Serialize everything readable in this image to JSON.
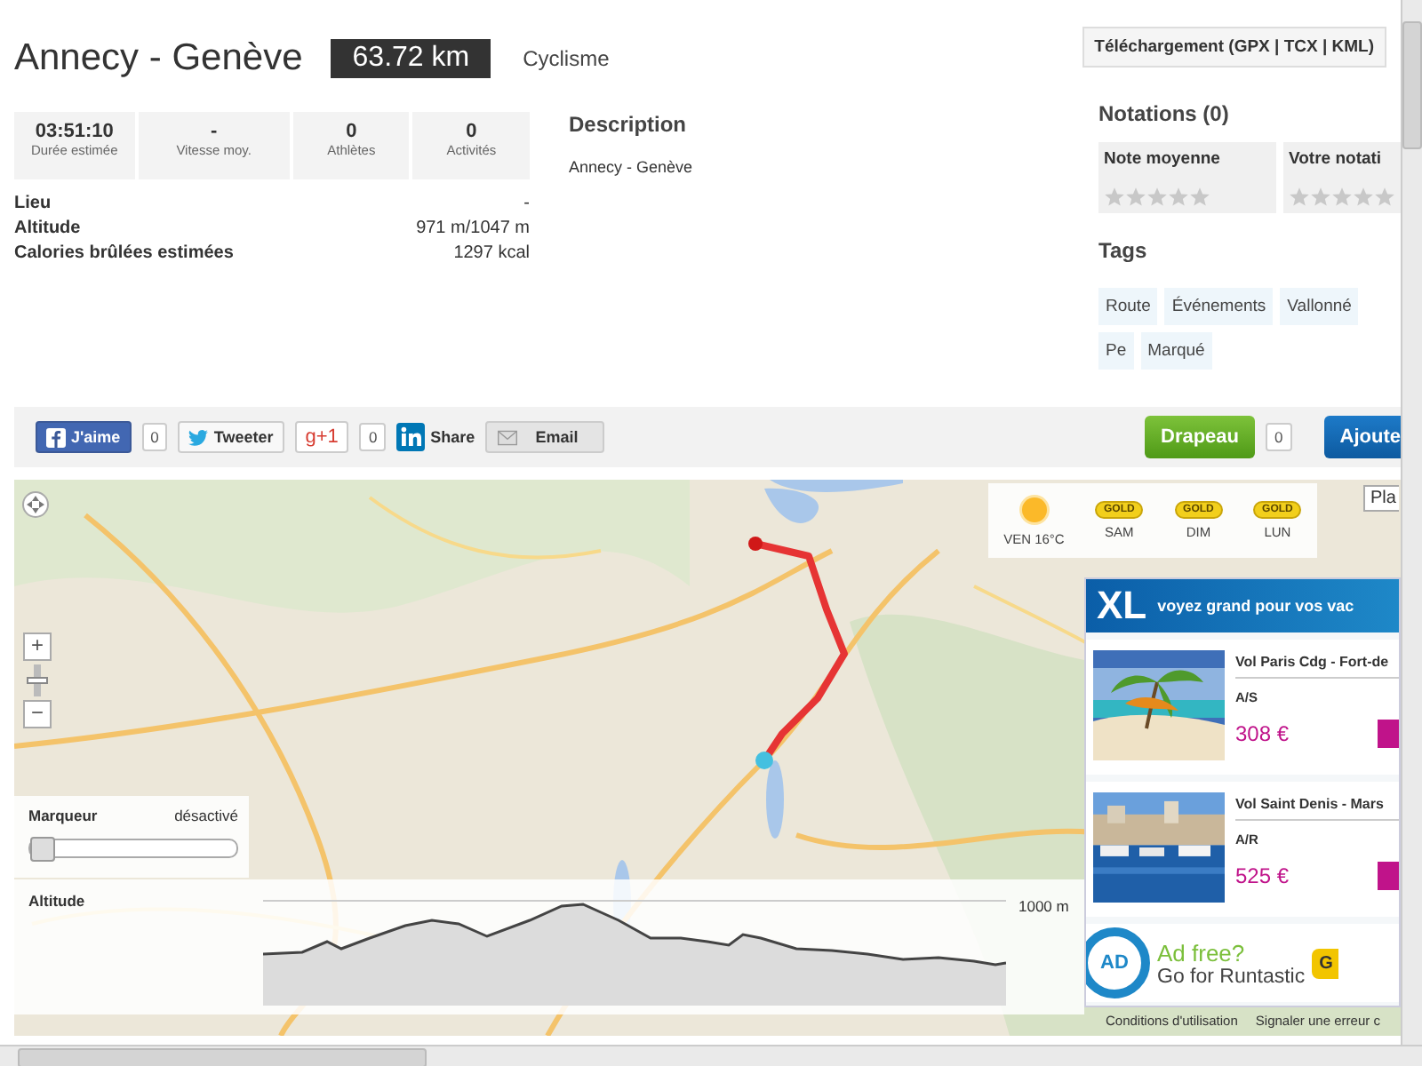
{
  "header": {
    "title": "Annecy - Genève",
    "distance": "63.72 km",
    "sport": "Cyclisme",
    "download": "Téléchargement (GPX | TCX | KML)"
  },
  "stats": [
    {
      "value": "03:51:10",
      "label": "Durée estimée"
    },
    {
      "value": "-",
      "label": "Vitesse moy."
    },
    {
      "value": "0",
      "label": "Athlètes"
    },
    {
      "value": "0",
      "label": "Activités"
    }
  ],
  "details": [
    {
      "label": "Lieu",
      "value": "-"
    },
    {
      "label": "Altitude",
      "value": "971 m/1047 m"
    },
    {
      "label": "Calories brûlées estimées",
      "value": "1297 kcal"
    }
  ],
  "description": {
    "heading": "Description",
    "text": "Annecy - Genève"
  },
  "ratings": {
    "heading": "Notations (0)",
    "boxes": [
      {
        "label": "Note moyenne",
        "stars": 0
      },
      {
        "label": "Votre notati",
        "stars": 0
      }
    ]
  },
  "tags": {
    "heading": "Tags",
    "items": [
      "Route",
      "Événements",
      "Vallonné",
      "Pe",
      "Marqué"
    ]
  },
  "social": [
    {
      "kind": "facebook",
      "label": "J'aime",
      "count": "0"
    },
    {
      "kind": "twitter",
      "label": "Tweeter"
    },
    {
      "kind": "gplus",
      "label": "g+1",
      "count": "0"
    },
    {
      "kind": "linkedin",
      "label": "Share"
    },
    {
      "kind": "email",
      "label": "Email"
    }
  ],
  "actions": [
    {
      "kind": "flag",
      "label": "Drapeau",
      "count": "0"
    },
    {
      "kind": "add",
      "label": "Ajoute"
    }
  ],
  "map": {
    "zoom": [
      "+",
      "−"
    ],
    "zoom_slider": {
      "level": 0.5
    },
    "weather": [
      {
        "kind": "sun",
        "day": "VEN 16°C"
      },
      {
        "kind": "badge",
        "badge": "GOLD",
        "day": "SAM"
      },
      {
        "kind": "badge",
        "badge": "GOLD",
        "day": "DIM"
      },
      {
        "kind": "badge",
        "badge": "GOLD",
        "day": "LUN"
      }
    ],
    "view_button": "Pla",
    "marker": {
      "title": "Marqueur",
      "status": "désactivé",
      "level": 0
    },
    "altitude": {
      "title": "Altitude",
      "tick": "1000 m"
    },
    "links": [
      "Conditions d'utilisation",
      "Signaler une erreur c"
    ]
  },
  "ad": {
    "logo": "XL",
    "slogan": "voyez grand pour vos vac",
    "offers": [
      {
        "kind": "beach",
        "title": "Vol Paris Cdg - Fort-de",
        "fare": "A/S",
        "price": "308 €"
      },
      {
        "kind": "harbour",
        "title": "Vol Saint Denis - Mars",
        "fare": "A/R",
        "price": "525 €"
      }
    ],
    "promo": {
      "logo": "AD",
      "title": "Ad free?",
      "text": "Go for Runtastic",
      "button": "G"
    }
  }
}
